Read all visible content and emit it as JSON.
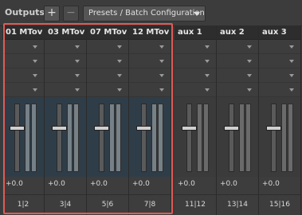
{
  "header": {
    "title": "Outputs",
    "add_label": "+",
    "remove_label": "−",
    "preset_label": "Presets / Batch Configuration"
  },
  "channels": [
    {
      "name": "01 MTov",
      "volume": "+0.0",
      "route": "1|2",
      "selected": true
    },
    {
      "name": "03 MTov",
      "volume": "+0.0",
      "route": "3|4",
      "selected": true
    },
    {
      "name": "07 MTov",
      "volume": "+0.0",
      "route": "5|6",
      "selected": true
    },
    {
      "name": "12 MTov",
      "volume": "+0.0",
      "route": "7|8",
      "selected": true
    },
    {
      "name": "aux 1",
      "volume": "+0.0",
      "route": "11|12",
      "selected": false
    },
    {
      "name": "aux 2",
      "volume": "+0.0",
      "route": "13|14",
      "selected": false
    },
    {
      "name": "aux 3",
      "volume": "+0.0",
      "route": "15|16",
      "selected": false
    }
  ],
  "colors": {
    "selection_border": "#e25a55",
    "selected_fader_bg": "#2f3d48"
  },
  "icons": {
    "add": "plus-icon",
    "remove": "minus-icon",
    "dropdown": "chevron-down-icon"
  }
}
